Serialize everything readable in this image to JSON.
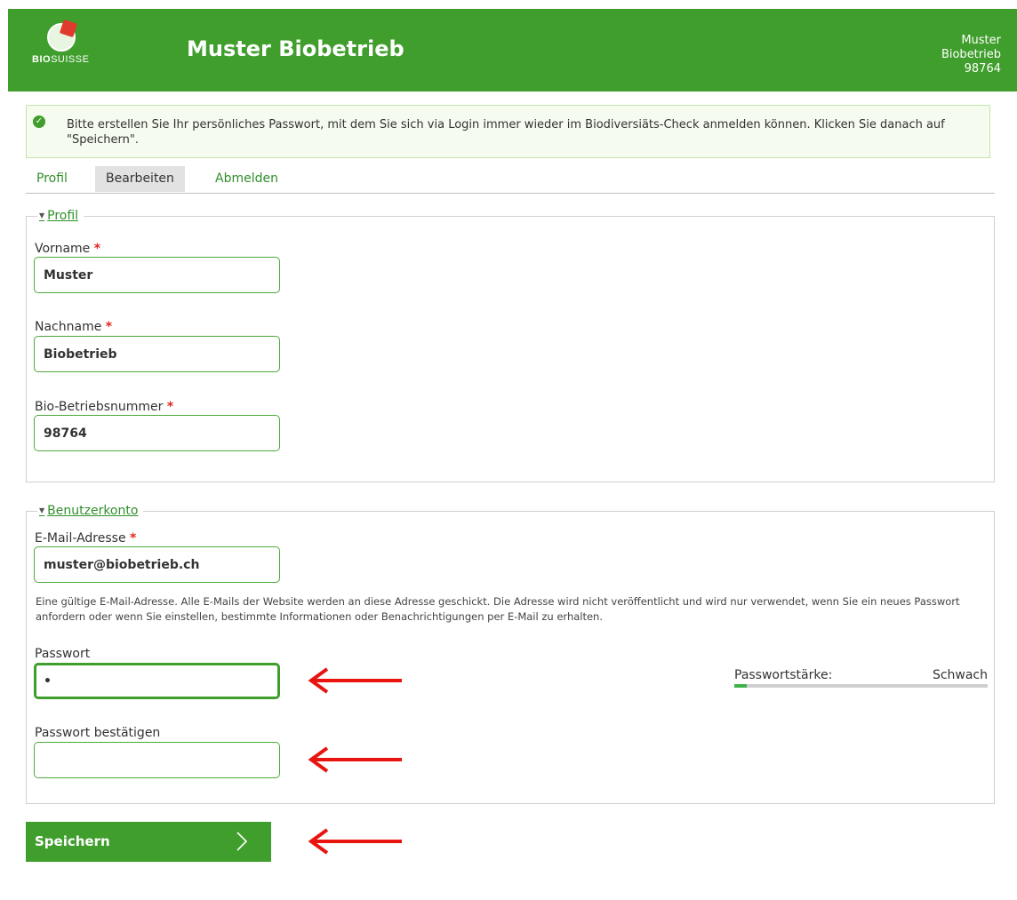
{
  "header": {
    "logo_text_bold": "BIO",
    "logo_text": "SUISSE",
    "site_title": "Muster Biobetrieb",
    "user_lines": [
      "Muster",
      "Biobetrieb",
      "98764"
    ]
  },
  "notice": {
    "icon": "check-circle-icon",
    "text": "Bitte erstellen Sie Ihr persönliches Passwort, mit dem Sie sich via Login immer wieder im Biodiversiäts-Check anmelden können. Klicken Sie danach auf \"Speichern\"."
  },
  "tabs": [
    {
      "label": "Profil",
      "active": false
    },
    {
      "label": "Bearbeiten",
      "active": true
    },
    {
      "label": "Abmelden",
      "active": false
    }
  ],
  "profile_section": {
    "legend": "Profil",
    "fields": [
      {
        "label": "Vorname",
        "required": "*",
        "value": "Muster"
      },
      {
        "label": "Nachname",
        "required": "*",
        "value": "Biobetrieb"
      },
      {
        "label": "Bio-Betriebsnummer",
        "required": "*",
        "value": "98764"
      }
    ]
  },
  "account_section": {
    "legend": "Benutzerkonto",
    "email": {
      "label": "E-Mail-Adresse",
      "required": "*",
      "value": "muster@biobetrieb.ch",
      "help": "Eine gültige E-Mail-Adresse. Alle E-Mails der Website werden an diese Adresse geschickt. Die Adresse wird nicht veröffentlicht und wird nur verwendet, wenn Sie ein neues Passwort anfordern oder wenn Sie einstellen, bestimmte Informationen oder Benachrichtigungen per E-Mail zu erhalten."
    },
    "password": {
      "label": "Passwort",
      "value": "•"
    },
    "password_confirm": {
      "label": "Passwort bestätigen",
      "value": ""
    },
    "strength": {
      "label": "Passwortstärke:",
      "value": "Schwach",
      "level": 0.05
    }
  },
  "save_button": {
    "label": "Speichern",
    "icon": "chevron-right-icon"
  },
  "annotations": {
    "arrow_color": "#e8140f",
    "arrow_icon": "arrow-left-icon"
  },
  "colors": {
    "brand_green": "#3f9e2c",
    "link_green": "#2f8f2a",
    "required_red": "#e0281e"
  }
}
